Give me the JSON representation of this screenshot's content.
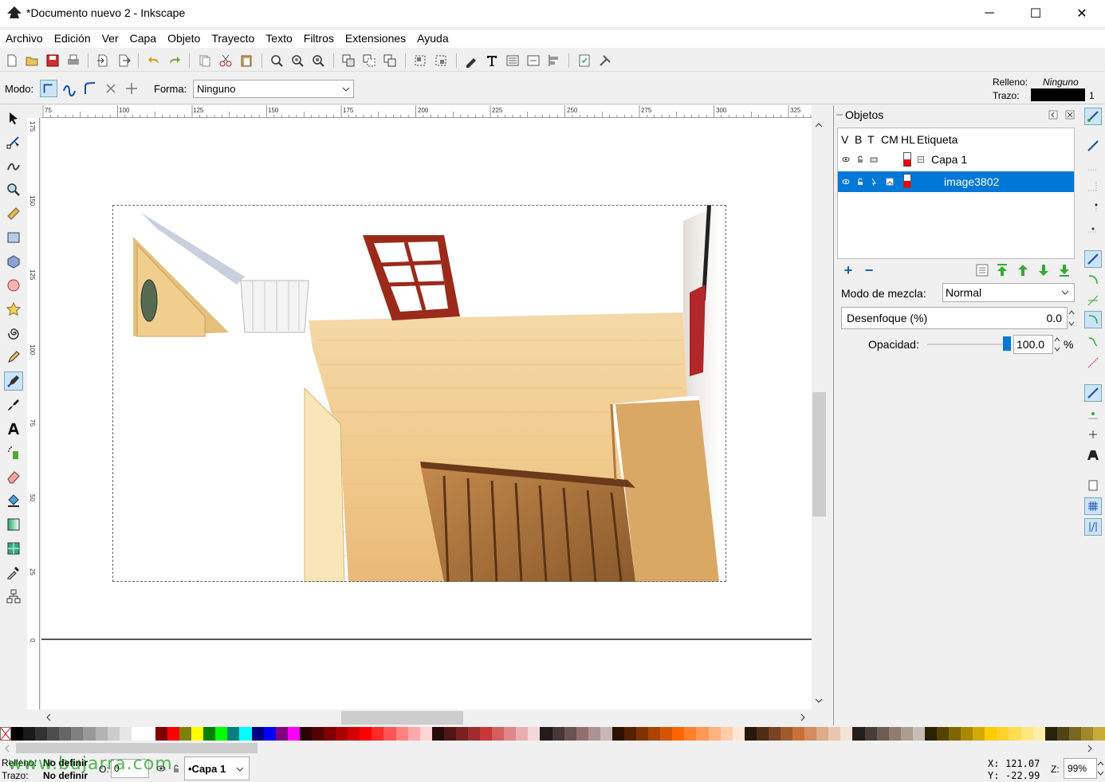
{
  "window": {
    "title": "*Documento nuevo 2 - Inkscape",
    "minimize": "─",
    "maximize": "☐",
    "close": "✕"
  },
  "menu": [
    "Archivo",
    "Edición",
    "Ver",
    "Capa",
    "Objeto",
    "Trayecto",
    "Texto",
    "Filtros",
    "Extensiones",
    "Ayuda"
  ],
  "controls": {
    "mode_label": "Modo:",
    "shape_label": "Forma:",
    "shape_value": "Ninguno",
    "fill_label": "Relleno:",
    "fill_value": "Ninguno",
    "stroke_label": "Trazo:",
    "stroke_width": "1"
  },
  "ruler": {
    "top": [
      "75",
      "100",
      "125",
      "150",
      "175",
      "200",
      "225",
      "250",
      "275",
      "300",
      "325"
    ],
    "left": [
      "175",
      "150",
      "125",
      "100",
      "75",
      "50",
      "25",
      "0"
    ]
  },
  "objects_panel": {
    "title": "Objetos",
    "columns": [
      "V",
      "B",
      "T",
      "CM",
      "HL",
      "Etiqueta"
    ],
    "rows": [
      {
        "label": "Capa 1",
        "expander": "⊟"
      },
      {
        "label": "image3802"
      }
    ],
    "blend_label": "Modo de mezcla:",
    "blend_value": "Normal",
    "blur_label": "Desenfoque (%)",
    "blur_value": "0.0",
    "opacity_label": "Opacidad:",
    "opacity_value": "100.0",
    "opacity_unit": "%",
    "opacity_level": 1.0
  },
  "palette": [
    "#000000",
    "#1a1a1a",
    "#333333",
    "#4d4d4d",
    "#666666",
    "#808080",
    "#999999",
    "#b3b3b3",
    "#cccccc",
    "#e6e6e6",
    "#ffffff",
    "#ffffff",
    "#800000",
    "#ff0000",
    "#808000",
    "#ffff00",
    "#008000",
    "#00ff00",
    "#008080",
    "#00ffff",
    "#000080",
    "#0000ff",
    "#800080",
    "#ff00ff",
    "#2b0000",
    "#550000",
    "#800000",
    "#aa0000",
    "#d40000",
    "#ff0000",
    "#ff2a2a",
    "#ff5555",
    "#ff8080",
    "#ffaaaa",
    "#ffd5d5",
    "#280b0b",
    "#501616",
    "#782121",
    "#a02c2c",
    "#c83737",
    "#d35f5f",
    "#de8787",
    "#e9afaf",
    "#f4d7d7",
    "#241c1c",
    "#483737",
    "#6c5353",
    "#916f6f",
    "#ac9393",
    "#c8b7b7",
    "#2b1100",
    "#552200",
    "#803300",
    "#aa4400",
    "#d45500",
    "#ff6600",
    "#ff7f2a",
    "#ff9955",
    "#ffb380",
    "#ffccaa",
    "#ffe6d5",
    "#28170b",
    "#502d16",
    "#784421",
    "#a05a2c",
    "#c87137",
    "#d38d5f",
    "#deaa87",
    "#e9c6af",
    "#f4e3d7",
    "#241f1c",
    "#483e37",
    "#6c5d53",
    "#917c6f",
    "#ac9d93",
    "#c8beb7",
    "#2b2200",
    "#554400",
    "#806600",
    "#aa8800",
    "#d4aa00",
    "#ffcc00",
    "#ffd42a",
    "#ffdd55",
    "#ffe680",
    "#ffeeaa",
    "#28220b",
    "#504416",
    "#786721",
    "#a0892c",
    "#c8ab37"
  ],
  "status": {
    "fill_label": "Relleno:",
    "fill_value": "No definir",
    "stroke_label": "Trazo:",
    "stroke_value": "No definir",
    "opacity_label": "O:",
    "opacity_value": "0",
    "layer": "•Capa 1",
    "x_label": "X:",
    "y_label": "Y:",
    "x": "121.07",
    "y": "-22.99",
    "zoom_label": "Z:",
    "zoom": "99%"
  },
  "watermark": "www.bujarra.com"
}
